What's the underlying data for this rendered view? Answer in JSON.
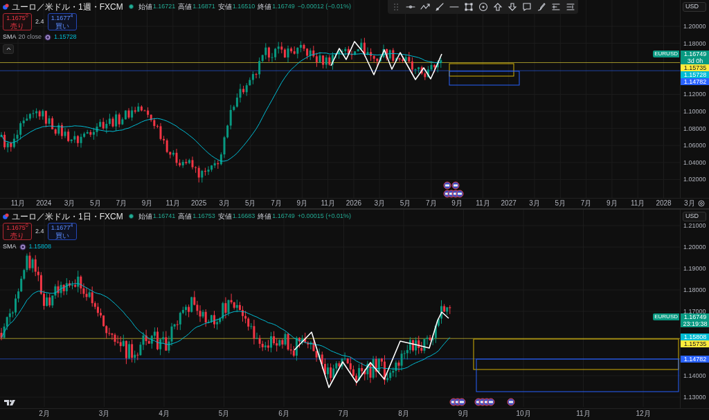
{
  "panes": [
    {
      "title": "ユーロ／米ドル・1週・FXCM",
      "collapse_button": true,
      "ohlc": [
        {
          "label": "始値",
          "value": "1.16721"
        },
        {
          "label": "高値",
          "value": "1.16871"
        },
        {
          "label": "安値",
          "value": "1.16510"
        },
        {
          "label": "終値",
          "value": "1.16749"
        }
      ],
      "change": "−0.00012 (−0.01%)",
      "sell": {
        "price": "1.1675$^{0}$",
        "label": "売り"
      },
      "spread": "2.4",
      "buy": {
        "price": "1.1677$^{4}$",
        "label": "買い"
      },
      "indicator": {
        "name": "SMA",
        "params": "20 close",
        "value": "1.15728"
      },
      "currency": "USD",
      "price_axis": [
        "1.20000",
        "1.18000",
        "1.12000",
        "1.10000",
        "1.08000",
        "1.06000",
        "1.04000",
        "1.02000"
      ],
      "price_labels": [
        {
          "kind": "symbol",
          "label": "EURUSD",
          "value": "1.16749",
          "sub": "3d 0h",
          "color": "#089981"
        },
        {
          "kind": "level",
          "value": "1.15735",
          "color": "#ffeb3b"
        },
        {
          "kind": "sma",
          "value": "1.15728",
          "color": "#00bcd4"
        },
        {
          "kind": "level",
          "value": "1.14782",
          "color": "#2962ff"
        }
      ],
      "time_axis": [
        "11月",
        "2024",
        "3月",
        "5月",
        "7月",
        "9月",
        "11月",
        "2025",
        "3月",
        "5月",
        "7月",
        "9月",
        "11月",
        "2026",
        "3月",
        "5月",
        "7月",
        "9月",
        "11月",
        "2027",
        "3月",
        "5月",
        "7月",
        "9月",
        "11月",
        "2028",
        "3月"
      ]
    },
    {
      "title": "ユーロ／米ドル・1日・FXCM",
      "ohlc": [
        {
          "label": "始値",
          "value": "1.16741"
        },
        {
          "label": "高値",
          "value": "1.16753"
        },
        {
          "label": "安値",
          "value": "1.16683"
        },
        {
          "label": "終値",
          "value": "1.16749"
        }
      ],
      "change": "+0.00015 (+0.01%)",
      "sell": {
        "price": "1.1675$^{0}$",
        "label": "売り"
      },
      "spread": "2.4",
      "buy": {
        "price": "1.1677$^{4}$",
        "label": "買い"
      },
      "indicator": {
        "name": "SMA",
        "value": "1.15808"
      },
      "currency": "USD",
      "price_axis": [
        "1.21000",
        "1.20000",
        "1.19000",
        "1.18000",
        "1.17000",
        "1.14000",
        "1.13000"
      ],
      "price_labels": [
        {
          "kind": "symbol",
          "label": "EURUSD",
          "value": "1.16749",
          "sub": "23:19:38",
          "color": "#089981"
        },
        {
          "kind": "sma",
          "value": "1.15808",
          "color": "#00bcd4"
        },
        {
          "kind": "level",
          "value": "1.15735",
          "color": "#ffeb3b"
        },
        {
          "kind": "level",
          "value": "1.14782",
          "color": "#2962ff"
        }
      ],
      "time_axis": [
        "2月",
        "3月",
        "4月",
        "5月",
        "6月",
        "7月",
        "8月",
        "9月",
        "10月",
        "11月",
        "12月"
      ]
    }
  ]
}
